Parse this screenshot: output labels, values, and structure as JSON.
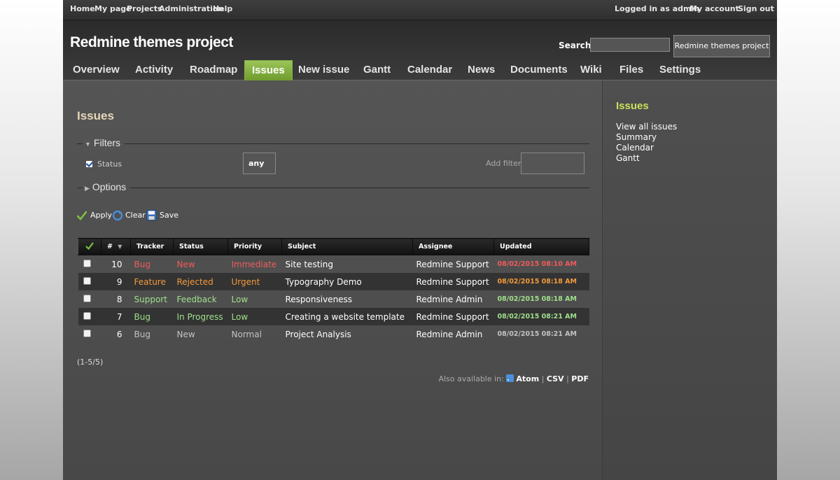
{
  "topmenu": {
    "items": [
      "Home",
      "My page",
      "Projects",
      "Administration",
      "Help"
    ],
    "logged_prefix": "Logged in as",
    "user": "admin",
    "my_account": "My account",
    "sign_out": "Sign out"
  },
  "header": {
    "title": "Redmine themes project",
    "search_label": "Search:",
    "search_value": "",
    "project_jump": "Redmine themes project"
  },
  "tabs": [
    "Overview",
    "Activity",
    "Roadmap",
    "Issues",
    "New issue",
    "Gantt",
    "Calendar",
    "News",
    "Documents",
    "Wiki",
    "Files",
    "Settings"
  ],
  "selected_tab": "Issues",
  "main": {
    "title": "Issues",
    "filters_legend": "Filters",
    "status_filter_label": "Status",
    "status_filter_checked": true,
    "status_operator": "any",
    "add_filter_label": "Add filter",
    "options_legend": "Options",
    "apply": "Apply",
    "clear": "Clear",
    "save": "Save"
  },
  "table": {
    "headers": [
      "#",
      "Tracker",
      "Status",
      "Priority",
      "Subject",
      "Assignee",
      "Updated"
    ],
    "rows": [
      {
        "id": "10",
        "tracker": "Bug",
        "status": "New",
        "priority": "Immediate",
        "subject": "Site testing",
        "assignee": "Redmine Support",
        "updated": "08/02/2015 08:10 AM",
        "color": "#f15b5b"
      },
      {
        "id": "9",
        "tracker": "Feature",
        "status": "Rejected",
        "priority": "Urgent",
        "subject": "Typography Demo",
        "assignee": "Redmine Support",
        "updated": "08/02/2015 08:18 AM",
        "color": "#f39a3b"
      },
      {
        "id": "8",
        "tracker": "Support",
        "status": "Feedback",
        "priority": "Low",
        "subject": "Responsiveness",
        "assignee": "Redmine Admin",
        "updated": "08/02/2015 08:18 AM",
        "color": "#9fe08c"
      },
      {
        "id": "7",
        "tracker": "Bug",
        "status": "In Progress",
        "priority": "Low",
        "subject": "Creating a website template",
        "assignee": "Redmine Support",
        "updated": "08/02/2015 08:21 AM",
        "color": "#9fe08c"
      },
      {
        "id": "6",
        "tracker": "Bug",
        "status": "New",
        "priority": "Normal",
        "subject": "Project Analysis",
        "assignee": "Redmine Admin",
        "updated": "08/02/2015 08:21 AM",
        "color": "#c2c2c2"
      }
    ]
  },
  "pagination": "(1-5/5)",
  "also_available": {
    "label": "Also available in:",
    "formats": [
      "Atom",
      "CSV",
      "PDF"
    ]
  },
  "sidebar": {
    "title": "Issues",
    "links": [
      "View all issues",
      "Summary",
      "Calendar",
      "Gantt"
    ]
  },
  "colors": {
    "accent_tab": "#7fab3c",
    "sidebar_title": "#c9e05c",
    "main_title": "#e8d8b8"
  }
}
